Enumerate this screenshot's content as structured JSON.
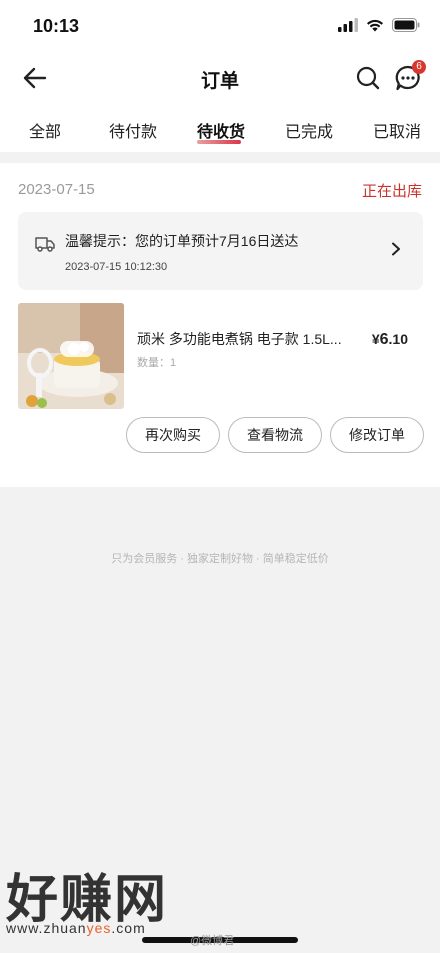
{
  "status_bar": {
    "time": "10:13"
  },
  "header": {
    "title": "订单",
    "badge_count": "6"
  },
  "tabs": [
    {
      "label": "全部"
    },
    {
      "label": "待付款"
    },
    {
      "label": "待收货"
    },
    {
      "label": "已完成"
    },
    {
      "label": "已取消"
    }
  ],
  "active_tab": "待收货",
  "order": {
    "date": "2023-07-15",
    "status": "正在出库",
    "status_color": "#c9342f",
    "notice": {
      "text": "温馨提示：您的订单预计7月16日送达",
      "time": "2023-07-15 10:12:30"
    },
    "product": {
      "title": "顽米 多功能电煮锅 电子款 1.5L...",
      "quantity": "数量：1",
      "price_symbol": "¥",
      "price_int": "6",
      "price_dec": ".10"
    },
    "buttons": {
      "rebuy": "再次购买",
      "logistics": "查看物流",
      "modify": "修改订单"
    }
  },
  "footer": {
    "slogan": "只为会员服务 · 独家定制好物 · 简单稳定低价"
  },
  "watermark": {
    "main": "好赚网",
    "url_prefix": "www.zhuan",
    "url_highlight": "yes",
    "url_suffix": ".com",
    "weibo": "@微博君"
  }
}
